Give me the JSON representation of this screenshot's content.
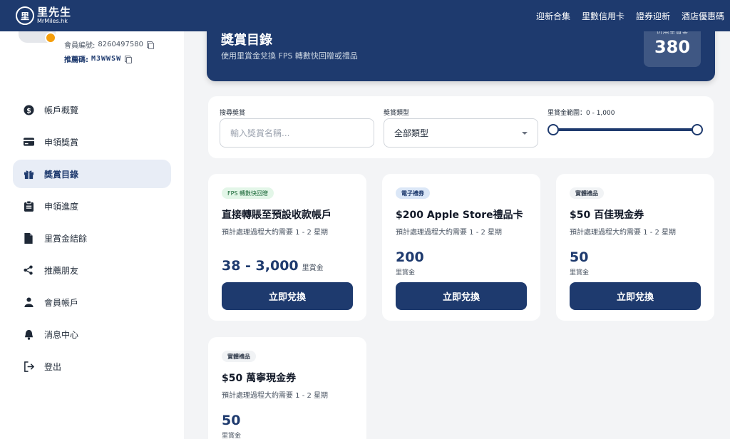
{
  "brand": {
    "name": "里先生",
    "sub": "MrMiles.hk"
  },
  "nav": [
    "迎新合集",
    "里數信用卡",
    "證券迎新",
    "酒店優惠碼"
  ],
  "profile": {
    "member_label": "會員編號:",
    "member_no": "8260497580",
    "ref_label": "推薦碼:",
    "ref_code": "M3WWSW"
  },
  "menu": [
    {
      "label": "帳戶概覽",
      "icon": "dollar-circle-icon",
      "active": false
    },
    {
      "label": "申領獎賞",
      "icon": "credit-card-icon",
      "active": false
    },
    {
      "label": "獎賞目錄",
      "icon": "gift-icon",
      "active": true
    },
    {
      "label": "申領進度",
      "icon": "clipboard-icon",
      "active": false
    },
    {
      "label": "里賞金結餘",
      "icon": "document-icon",
      "active": false
    },
    {
      "label": "推薦朋友",
      "icon": "share-icon",
      "active": false
    },
    {
      "label": "會員帳戶",
      "icon": "user-icon",
      "active": false
    },
    {
      "label": "消息中心",
      "icon": "bell-icon",
      "active": false
    },
    {
      "label": "登出",
      "icon": "logout-icon",
      "active": false
    }
  ],
  "hero": {
    "title": "獎賞目錄",
    "subtitle": "使用里賞金兌換 FPS 轉數快回贈或禮品",
    "balance_label": "可用里賞金",
    "balance": "380"
  },
  "filters": {
    "search_label": "搜尋獎賞",
    "search_placeholder": "輸入獎賞名稱...",
    "type_label": "獎賞類型",
    "type_value": "全部類型",
    "range_label": "里賞金範圍：0 - 1,000",
    "range_min": 0,
    "range_max": 1000
  },
  "cards": [
    {
      "tag": "FPS 轉數快回贈",
      "title": "直接轉賬至預設收款帳戶",
      "desc": "預計處理過程大約需要 1 - 2 星期",
      "price": "38 - 3,000",
      "unit": "里賞金",
      "button": "立即兌換"
    },
    {
      "tag": "電子禮券",
      "title": "$200 Apple Store禮品卡",
      "desc": "預計處理過程大約需要 1 - 2 星期",
      "price": "200",
      "unit": "里賞金",
      "button": "立即兌換"
    },
    {
      "tag": "實體禮品",
      "title": "$50 百佳現金券",
      "desc": "預計處理過程大約需要 1 - 2 星期",
      "price": "50",
      "unit": "里賞金",
      "button": "立即兌換"
    },
    {
      "tag": "實體禮品",
      "title": "$50 萬寧現金券",
      "desc": "預計處理過程大約需要 1 - 2 星期",
      "price": "50",
      "unit": "里賞金",
      "button": "立即兌換"
    }
  ]
}
